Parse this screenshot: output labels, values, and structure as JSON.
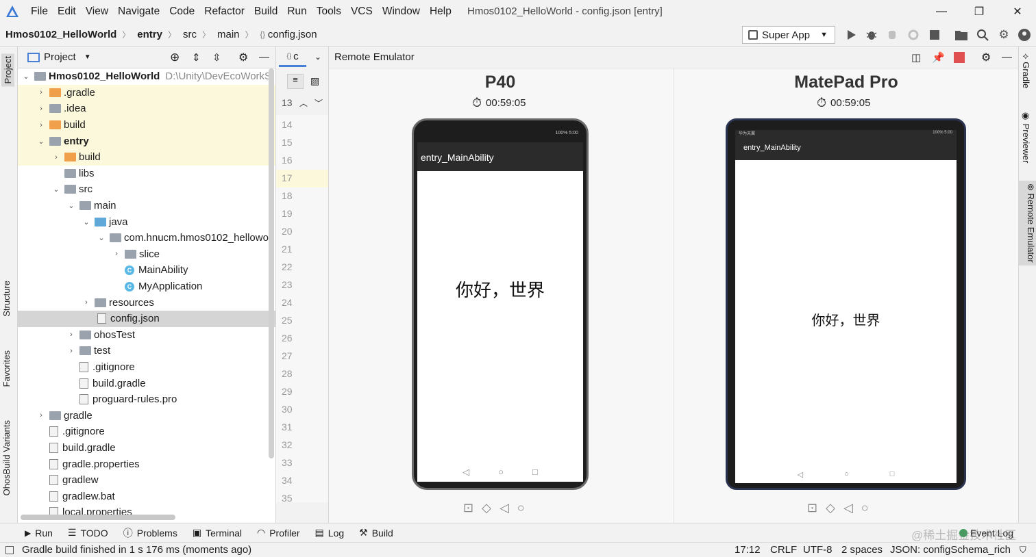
{
  "menu": {
    "items": [
      "File",
      "Edit",
      "View",
      "Navigate",
      "Code",
      "Refactor",
      "Build",
      "Run",
      "Tools",
      "VCS",
      "Window",
      "Help"
    ],
    "window_title": "Hmos0102_HelloWorld - config.json [entry]"
  },
  "breadcrumb": {
    "project": "Hmos0102_HelloWorld",
    "module": "entry",
    "dir1": "src",
    "dir2": "main",
    "file": "config.json"
  },
  "run_config": {
    "label": "Super App"
  },
  "project_panel": {
    "title": "Project",
    "root_name": "Hmos0102_HelloWorld",
    "root_path": "D:\\Unity\\DevEcoWorkS",
    "items": [
      {
        "label": ".gradle"
      },
      {
        "label": ".idea"
      },
      {
        "label": "build"
      },
      {
        "label": "entry"
      },
      {
        "label": "build"
      },
      {
        "label": "libs"
      },
      {
        "label": "src"
      },
      {
        "label": "main"
      },
      {
        "label": "java"
      },
      {
        "label": "com.hnucm.hmos0102_hellowor"
      },
      {
        "label": "slice"
      },
      {
        "label": "MainAbility"
      },
      {
        "label": "MyApplication"
      },
      {
        "label": "resources"
      },
      {
        "label": "config.json"
      },
      {
        "label": "ohosTest"
      },
      {
        "label": "test"
      },
      {
        "label": ".gitignore"
      },
      {
        "label": "build.gradle"
      },
      {
        "label": "proguard-rules.pro"
      },
      {
        "label": "gradle"
      },
      {
        "label": ".gitignore"
      },
      {
        "label": "build.gradle"
      },
      {
        "label": "gradle.properties"
      },
      {
        "label": "gradlew"
      },
      {
        "label": "gradlew.bat"
      },
      {
        "label": "local.properties"
      }
    ]
  },
  "editor": {
    "tab_label": "c",
    "line_numbers": [
      "13",
      "14",
      "15",
      "16",
      "17",
      "18",
      "19",
      "20",
      "21",
      "22",
      "23",
      "24",
      "25",
      "26",
      "27",
      "28",
      "29",
      "30",
      "31",
      "32",
      "33",
      "34",
      "35"
    ]
  },
  "left_tabs": {
    "project": "Project",
    "structure": "Structure",
    "favorites": "Favorites",
    "build_variants": "OhosBuild Variants"
  },
  "right_tabs": {
    "gradle": "Gradle",
    "previewer": "Previewer",
    "remote_emulator": "Remote Emulator"
  },
  "emulator": {
    "panel_title": "Remote Emulator",
    "devices": [
      {
        "name": "P40",
        "timer": "00:59:05",
        "status_left": "",
        "status_right": "100% 5:00",
        "app_title": "entry_MainAbility",
        "content": "你好，世界"
      },
      {
        "name": "MatePad Pro",
        "timer": "00:59:05",
        "status_left": "华为天翼",
        "status_right": "100% 5:00",
        "app_title": "entry_MainAbility",
        "content": "你好，世界"
      }
    ]
  },
  "bottom_tools": [
    "Run",
    "TODO",
    "Problems",
    "Terminal",
    "Profiler",
    "Log",
    "Build"
  ],
  "event_log": "Event Log",
  "status": {
    "message": "Gradle build finished in 1 s 176 ms (moments ago)",
    "position": "17:12",
    "line_sep": "CRLF",
    "encoding": "UTF-8",
    "indent": "2 spaces",
    "schema": "JSON: configSchema_rich"
  },
  "watermark": "@稀土掘金技术社区",
  "colors": {
    "accent": "#4a7fd6",
    "folder": "#9aa3ad",
    "excluded_folder": "#f0a04a",
    "source_folder": "#5fa8d8",
    "stop_red": "#e05050",
    "highlight": "#fcf8dc"
  }
}
